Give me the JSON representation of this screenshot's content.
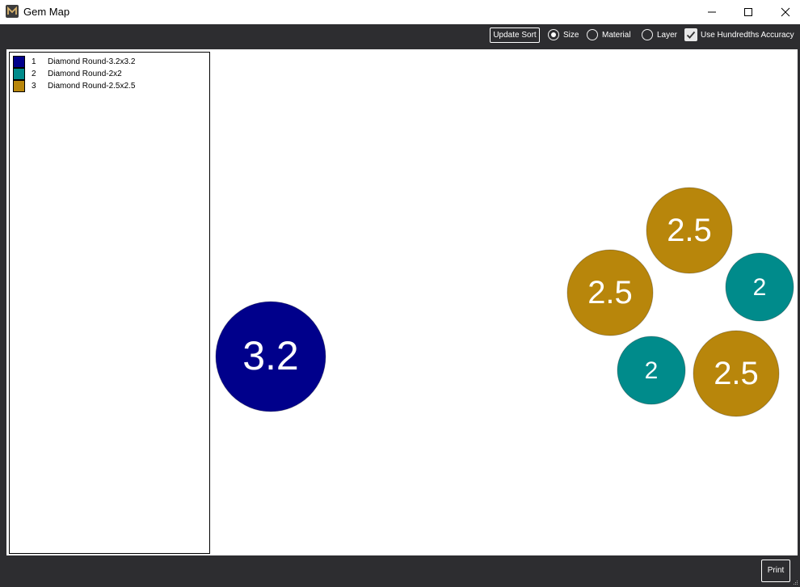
{
  "window": {
    "title": "Gem Map",
    "icon": "app-logo-icon",
    "controls": [
      "minimize-icon",
      "maximize-icon",
      "close-icon"
    ]
  },
  "toolbar": {
    "update_sort_label": "Update Sort",
    "sort_options": [
      {
        "label": "Size",
        "selected": true
      },
      {
        "label": "Material",
        "selected": false
      },
      {
        "label": "Layer",
        "selected": false
      }
    ],
    "hundredths_label": "Use Hundredths Accuracy",
    "hundredths_checked": true
  },
  "legend": {
    "items": [
      {
        "num": "1",
        "name": "Diamond Round-3.2x3.2",
        "color": "#00008b"
      },
      {
        "num": "2",
        "name": "Diamond Round-2x2",
        "color": "#008b8b"
      },
      {
        "num": "3",
        "name": "Diamond Round-2.5x2.5",
        "color": "#b8860b"
      }
    ]
  },
  "gems": [
    {
      "label": "3.2",
      "color": "#00008b"
    },
    {
      "label": "2.5",
      "color": "#b8860b"
    },
    {
      "label": "2.5",
      "color": "#b8860b"
    },
    {
      "label": "2",
      "color": "#008b8b"
    },
    {
      "label": "2",
      "color": "#008b8b"
    },
    {
      "label": "2.5",
      "color": "#b8860b"
    }
  ],
  "footer": {
    "print_label": "Print"
  }
}
